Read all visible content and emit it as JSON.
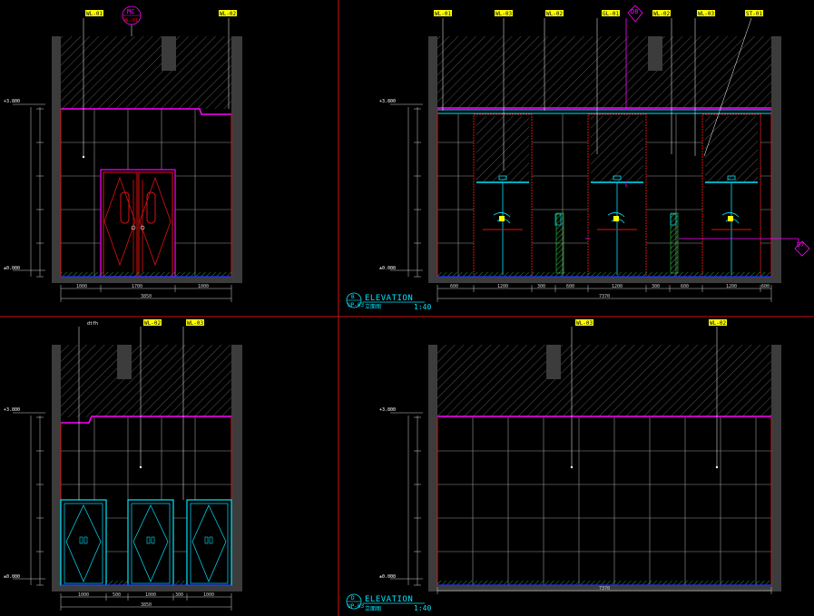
{
  "levels": {
    "ceiling": "+3.800",
    "floor": "±0.000"
  },
  "tags": {
    "a": [
      "WL-01",
      "WL-02"
    ],
    "b": [
      "WL-01",
      "WL-03",
      "WL-02",
      "GL-01",
      "WL-02",
      "WL-03",
      "ST-01"
    ],
    "c": [
      "WL-02",
      "WL-03"
    ],
    "d": [
      "WL-03",
      "WL-02"
    ]
  },
  "markers": {
    "mc": "MC",
    "mc_sub": "WL-01",
    "d8": "D8",
    "d7": "D7",
    "a_note": "dtfh"
  },
  "dims": {
    "a_bottom": [
      "1000",
      "1700",
      "1000"
    ],
    "a_total": "3850",
    "b_bottom": [
      "600",
      "1200",
      "300",
      "600",
      "1200",
      "300",
      "600",
      "1200",
      "600"
    ],
    "b_total": "7370",
    "c_bottom": [
      "1000",
      "500",
      "1000",
      "300",
      "1000"
    ],
    "c_total": "3850",
    "d_total": "7370"
  },
  "titles": {
    "b": {
      "letter": "B",
      "ref": "UP-03",
      "label": "ELEVATION",
      "sub": "立面图",
      "scale": "1:40"
    },
    "d": {
      "letter": "D",
      "ref": "UP-03",
      "label": "ELEVATION",
      "sub": "立面图",
      "scale": "1:40"
    }
  }
}
